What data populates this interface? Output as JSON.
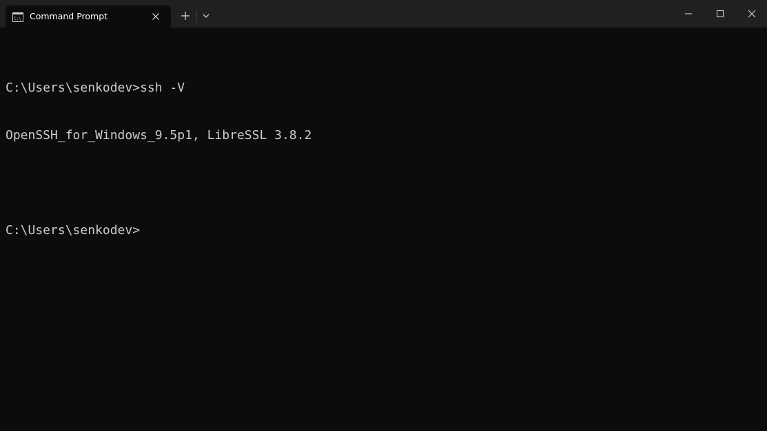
{
  "window": {
    "tab_title": "Command Prompt",
    "tab_icon": "cmd-icon"
  },
  "titlebar": {
    "new_tab_icon": "plus-icon",
    "dropdown_icon": "chevron-down-icon",
    "minimize_icon": "minimize-icon",
    "maximize_icon": "maximize-icon",
    "close_icon": "close-icon"
  },
  "console": {
    "lines": [
      "C:\\Users\\senkodev>ssh -V",
      "OpenSSH_for_Windows_9.5p1, LibreSSL 3.8.2",
      "",
      "C:\\Users\\senkodev>"
    ]
  },
  "colors": {
    "background": "#0c0c0c",
    "titlebar": "#202020",
    "text": "#cccccc"
  }
}
